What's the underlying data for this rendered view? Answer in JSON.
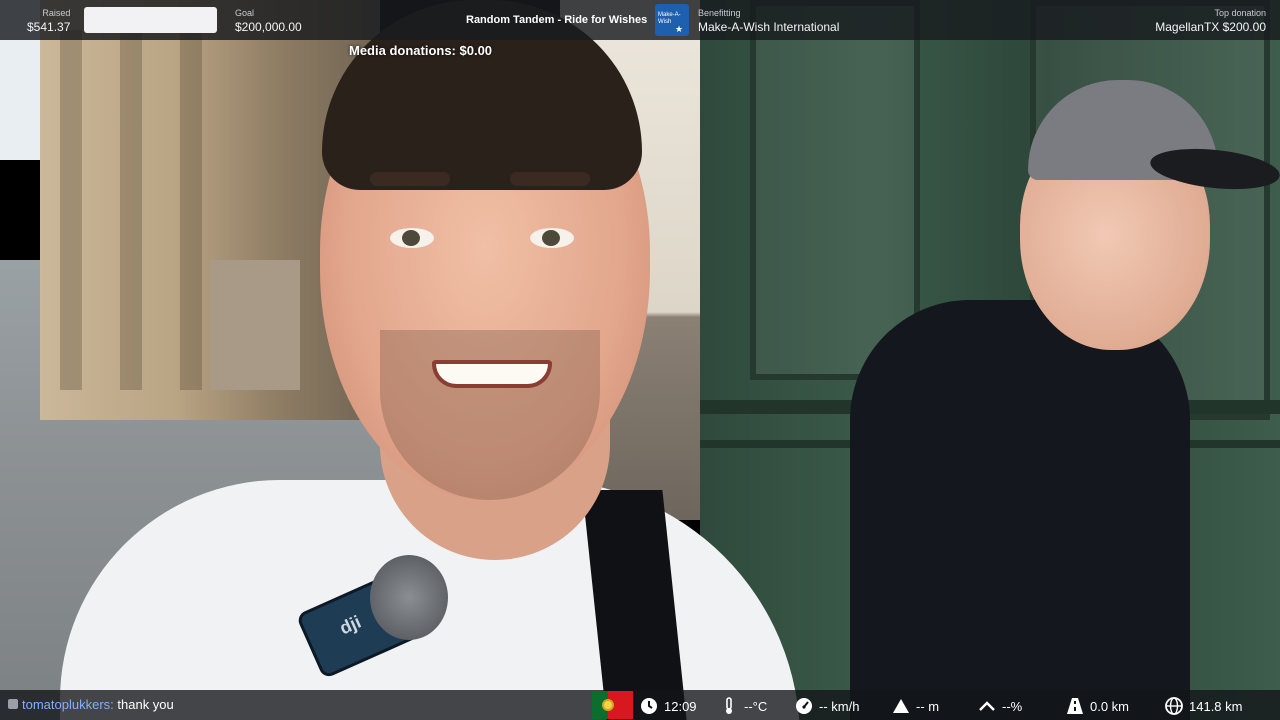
{
  "stream": {
    "raised_label": "Raised",
    "raised_value": "$541.37",
    "goal_label": "Goal",
    "goal_value": "$200,000.00",
    "campaign_title": "Random Tandem - Ride for Wishes",
    "charity_logo_text": "Make-A-Wish",
    "benefitting_label": "Benefitting",
    "benefitting_value": "Make-A-Wish International",
    "top_donation_label": "Top donation",
    "top_donation_value": "MagellanTX $200.00",
    "media_donations": "Media donations: $0.00"
  },
  "chat": {
    "username": "tomatoplukkers:",
    "message": "thank you"
  },
  "telemetry": {
    "time": "12:09",
    "temperature": "--°C",
    "speed": "-- km/h",
    "altitude": "-- m",
    "incline": "--%",
    "distance": "0.0 km",
    "total_distance": "141.8 km"
  },
  "icons": {
    "chat": "chat-icon",
    "flag": "portugal-flag-icon",
    "clock": "clock-icon",
    "thermometer": "thermometer-icon",
    "speedometer": "speedometer-icon",
    "mountain": "mountain-icon",
    "incline": "incline-icon",
    "road": "road-icon",
    "globe": "globe-icon"
  },
  "colors": {
    "chat_username": "#7fb0ff",
    "charity_blue": "#1f5fb0"
  }
}
